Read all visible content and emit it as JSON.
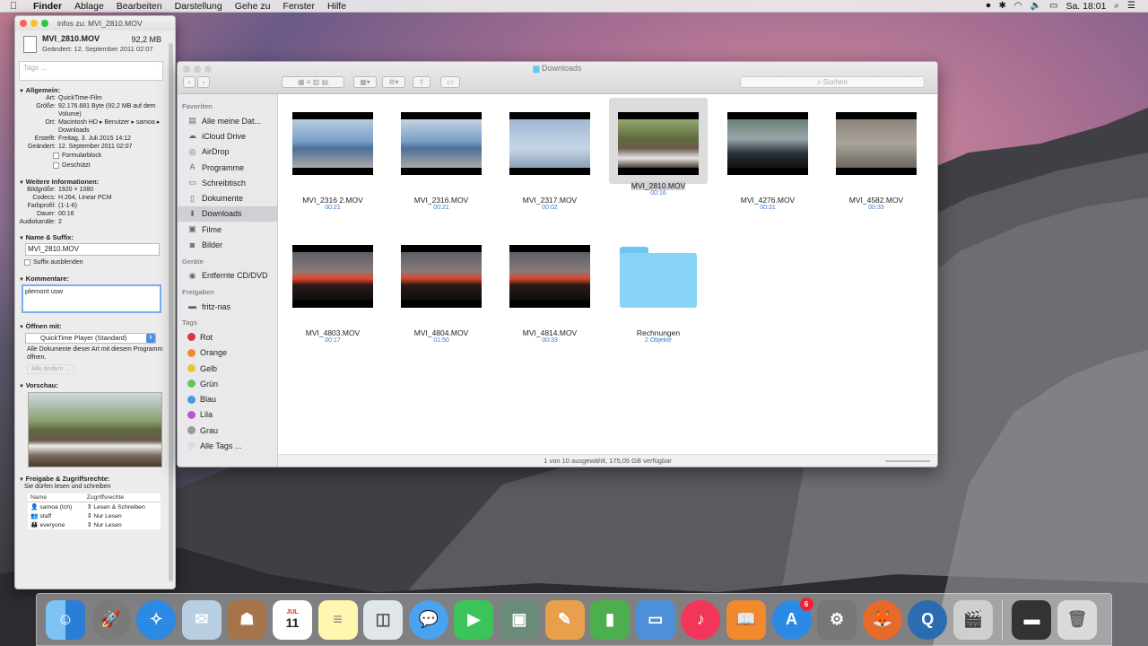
{
  "menubar": {
    "app": "Finder",
    "items": [
      "Ablage",
      "Bearbeiten",
      "Darstellung",
      "Gehe zu",
      "Fenster",
      "Hilfe"
    ],
    "clock": "Sa. 18:01"
  },
  "info_window": {
    "title": "infos zu: MVI_2810.MOV",
    "filename": "MVI_2810.MOV",
    "size": "92,2 MB",
    "modified": "Geändert: 12. September 2011 02:07",
    "tags_placeholder": "Tags ...",
    "general": {
      "heading": "Allgemein:",
      "art_k": "Art:",
      "art_v": "QuickTime-Film",
      "groesse_k": "Größe:",
      "groesse_v": "92.176.681 Byte (92,2 MB auf dem Volume)",
      "ort_k": "Ort:",
      "ort_v": "Macintosh HD ▸ Benutzer ▸ samoa ▸ Downloads",
      "erstellt_k": "Erstellt:",
      "erstellt_v": "Freitag, 3. Juli 2015 14:12",
      "geaendert_k": "Geändert:",
      "geaendert_v": "12. September 2011 02:07",
      "formularblock": "Formularblock",
      "geschuetzt": "Geschützt"
    },
    "more": {
      "heading": "Weitere Informationen:",
      "bildgroesse_k": "Bildgröße:",
      "bildgroesse_v": "1920 × 1080",
      "codecs_k": "Codecs:",
      "codecs_v": "H.264, Linear PCM",
      "farbprofil_k": "Farbprofil:",
      "farbprofil_v": "(1-1-6)",
      "dauer_k": "Dauer:",
      "dauer_v": "00:16",
      "audio_k": "Audiokanäle:",
      "audio_v": "2"
    },
    "name": {
      "heading": "Name & Suffix:",
      "value": "MVI_2810.MOV",
      "hide_suffix": "Suffix ausblenden"
    },
    "comments": {
      "heading": "Kommentare:",
      "value": "plemont usw"
    },
    "open_with": {
      "heading": "Öffnen mit:",
      "app": "QuickTime Player (Standard)",
      "note": "Alle Dokumente dieser Art mit diesem Programm öffnen.",
      "change_all": "Alle ändern ..."
    },
    "preview": {
      "heading": "Vorschau:"
    },
    "sharing": {
      "heading": "Freigabe & Zugriffsrechte:",
      "note": "Sie dürfen lesen und schreiben",
      "col_name": "Name",
      "col_rights": "Zugriffsrechte",
      "rows": [
        {
          "name": "samoa (Ich)",
          "rights": "Lesen & Schreiben"
        },
        {
          "name": "staff",
          "rights": "Nur Lesen"
        },
        {
          "name": "everyone",
          "rights": "Nur Lesen"
        }
      ]
    }
  },
  "finder": {
    "title": "Downloads",
    "search_placeholder": "Suchen",
    "sidebar": {
      "favorites_head": "Favoriten",
      "favorites": [
        "Alle meine Dat...",
        "iCloud Drive",
        "AirDrop",
        "Programme",
        "Schreibtisch",
        "Dokumente",
        "Downloads",
        "Filme",
        "Bilder"
      ],
      "devices_head": "Geräte",
      "devices": [
        "Entfernte CD/DVD"
      ],
      "shared_head": "Freigaben",
      "shared": [
        "fritz-nas"
      ],
      "tags_head": "Tags",
      "tags": [
        {
          "label": "Rot",
          "color": "#e0334a"
        },
        {
          "label": "Orange",
          "color": "#f08a2c"
        },
        {
          "label": "Gelb",
          "color": "#e8c630"
        },
        {
          "label": "Grün",
          "color": "#5cc85c"
        },
        {
          "label": "Blau",
          "color": "#3d9be8"
        },
        {
          "label": "Lila",
          "color": "#b45cc8"
        },
        {
          "label": "Grau",
          "color": "#999999"
        },
        {
          "label": "Alle Tags ...",
          "color": "#dddddd"
        }
      ]
    },
    "files": [
      {
        "name": "MVI_2316 2.MOV",
        "meta": "00:21"
      },
      {
        "name": "MVI_2316.MOV",
        "meta": "00:21"
      },
      {
        "name": "MVI_2317.MOV",
        "meta": "00:02"
      },
      {
        "name": "MVI_2810.MOV",
        "meta": "00:16"
      },
      {
        "name": "MVI_4276.MOV",
        "meta": "00:31"
      },
      {
        "name": "MVI_4582.MOV",
        "meta": "00:33"
      },
      {
        "name": "MVI_4803.MOV",
        "meta": "00:17"
      },
      {
        "name": "MVI_4804.MOV",
        "meta": "01:50"
      },
      {
        "name": "MVI_4814.MOV",
        "meta": "00:33"
      },
      {
        "name": "Rechnungen",
        "meta": "2 Objekte"
      }
    ],
    "status": "1 von 10 ausgewählt, 175,05 GB verfügbar"
  },
  "dock": {
    "calendar_month": "JUL",
    "calendar_day": "11",
    "appstore_badge": "6"
  }
}
